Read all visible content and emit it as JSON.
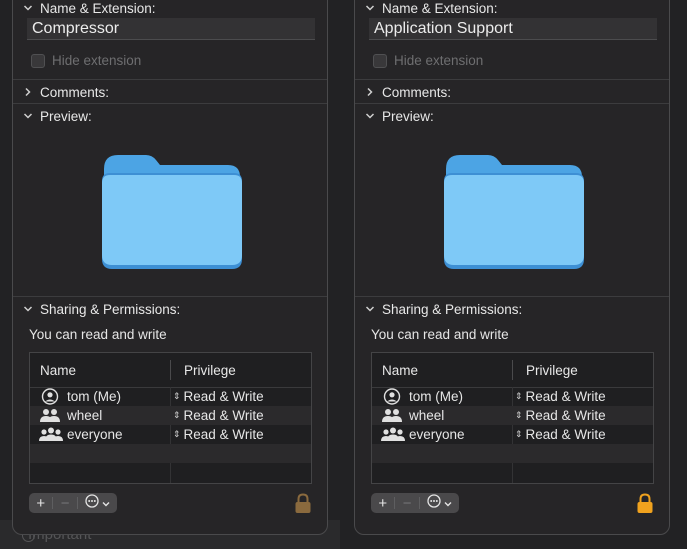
{
  "background": {
    "hint_text": "Important"
  },
  "panels": [
    {
      "name_section": {
        "label": "Name & Extension:",
        "filename": "Compressor",
        "hide_extension_label": "Hide extension"
      },
      "comments_label": "Comments:",
      "preview_label": "Preview:",
      "sharing": {
        "label": "Sharing & Permissions:",
        "status": "You can read and write",
        "columns": {
          "name": "Name",
          "privilege": "Privilege"
        },
        "rows": [
          {
            "name": "tom (Me)",
            "privilege": "Read & Write",
            "icon": "user-icon"
          },
          {
            "name": "wheel",
            "privilege": "Read & Write",
            "icon": "group-icon"
          },
          {
            "name": "everyone",
            "privilege": "Read & Write",
            "icon": "everyone-icon"
          }
        ]
      },
      "toolbar": {
        "add": "+",
        "remove": "−",
        "action": "⊙"
      },
      "lock_state": "locked",
      "lock_color": "#8a6a3e"
    },
    {
      "name_section": {
        "label": "Name & Extension:",
        "filename": "Application Support",
        "hide_extension_label": "Hide extension"
      },
      "comments_label": "Comments:",
      "preview_label": "Preview:",
      "sharing": {
        "label": "Sharing & Permissions:",
        "status": "You can read and write",
        "columns": {
          "name": "Name",
          "privilege": "Privilege"
        },
        "rows": [
          {
            "name": "tom (Me)",
            "privilege": "Read & Write",
            "icon": "user-icon"
          },
          {
            "name": "wheel",
            "privilege": "Read & Write",
            "icon": "group-icon"
          },
          {
            "name": "everyone",
            "privilege": "Read & Write",
            "icon": "everyone-icon"
          }
        ]
      },
      "toolbar": {
        "add": "+",
        "remove": "−",
        "action": "⊙"
      },
      "lock_state": "locked",
      "lock_color": "#f0a21e"
    }
  ],
  "colors": {
    "folder_front": "#7ec9f7",
    "folder_back": "#4ca4e4",
    "accent": "#1a84ff"
  }
}
